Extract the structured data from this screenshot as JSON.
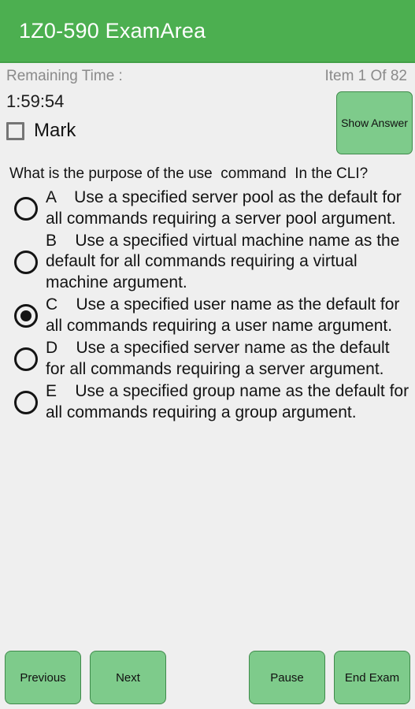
{
  "appbar": {
    "title": "1Z0-590 ExamArea",
    "background": "#4caf50",
    "text_color": "#ffffff"
  },
  "status": {
    "remaining_time_label": "Remaining Time :",
    "item_counter": "Item 1 Of 82"
  },
  "timer": {
    "value": "1:59:54"
  },
  "mark": {
    "label": "Mark",
    "checked": false
  },
  "show_answer": {
    "label": "Show Answer",
    "background": "#7ecb8b",
    "border": "#3f8a4b"
  },
  "question": {
    "text": "What is the purpose of the use  command  In the CLI?"
  },
  "options": [
    {
      "letter": "A",
      "text": "A    Use a specified server pool as the default for all commands requiring a server pool argument.",
      "selected": false
    },
    {
      "letter": "B",
      "text": "B    Use a specified virtual machine name as the default for all commands requiring a virtual machine argument.",
      "selected": false
    },
    {
      "letter": "C",
      "text": "C    Use a specified user name as the default for all commands requiring a user name argument.",
      "selected": true
    },
    {
      "letter": "D",
      "text": "D    Use a specified server name as the default for all commands requiring a server argument.",
      "selected": false
    },
    {
      "letter": "E",
      "text": "E    Use a specified group name as the default for all commands requiring a group argument.",
      "selected": false
    }
  ],
  "bottombar": {
    "previous_label": "Previous",
    "next_label": "Next",
    "pause_label": "Pause",
    "end_exam_label": "End Exam"
  }
}
